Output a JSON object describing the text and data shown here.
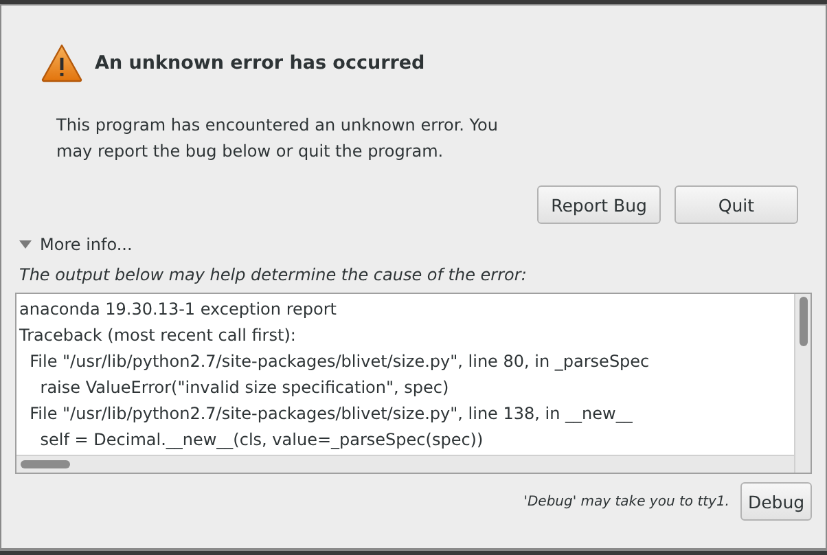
{
  "dialog": {
    "title": "An unknown error has occurred",
    "message": "This program has encountered an unknown error. You may report the bug below or quit the program.",
    "buttons": [
      "Report Bug",
      "Quit"
    ],
    "more_info": {
      "label": "More info...",
      "expanded": true
    },
    "hint": "The output below may help determine the cause of the error:",
    "output_lines": [
      "anaconda 19.30.13-1 exception report",
      "Traceback (most recent call first):",
      "  File \"/usr/lib/python2.7/site-packages/blivet/size.py\", line 80, in _parseSpec",
      "    raise ValueError(\"invalid size specification\", spec)",
      "  File \"/usr/lib/python2.7/site-packages/blivet/size.py\", line 138, in __new__",
      "    self = Decimal.__new__(cls, value=_parseSpec(spec))"
    ],
    "debug_note": "'Debug' may take you to tty1.",
    "debug_button": "Debug"
  }
}
